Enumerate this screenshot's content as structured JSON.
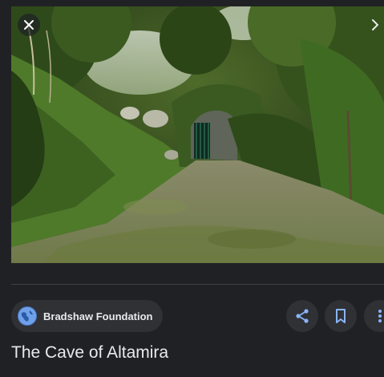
{
  "image": {
    "alt": ""
  },
  "controls": {
    "close_icon": "close-icon",
    "next_icon": "chevron-right-icon"
  },
  "source": {
    "name": "Bradshaw Foundation",
    "icon": "globe-icon"
  },
  "actions": {
    "share_icon": "share-icon",
    "save_icon": "bookmark-icon",
    "more_icon": "more-vert-icon"
  },
  "title": "The Cave of Altamira",
  "colors": {
    "background": "#202124",
    "chip_background": "#303134",
    "icon_blue": "#8ab4f8",
    "text": "#e8eaed"
  }
}
